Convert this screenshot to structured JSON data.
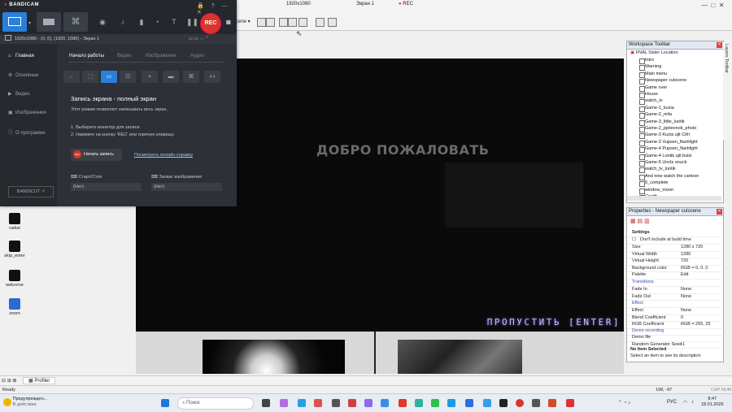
{
  "editor": {
    "tab_title": "1920x1080",
    "tab_title2": "Экран 1",
    "rec_label": "REC",
    "scene_label": "cene",
    "canvas": {
      "welcome_text": "ДОБРО ПОЖАЛОВАТЬ",
      "skip_text": "ПРОПУСТИТЬ [ENTER]"
    }
  },
  "desktop_icons": [
    {
      "label": "radial",
      "icon": "radial-icon"
    },
    {
      "label": "skip_enter",
      "icon": "skip-enter-icon"
    },
    {
      "label": "welcome",
      "icon": "welcome-icon"
    },
    {
      "label": "zoom",
      "icon": "zoom-icon"
    }
  ],
  "bandicam": {
    "logo": "BANDICAM",
    "rec_button": "REC",
    "subtitle": "1920x1080 - (0, 0), (1920, 1080) - Экран 1",
    "sidebar": [
      {
        "label": "Главная",
        "icon": "home-icon",
        "active": true
      },
      {
        "label": "Основные",
        "icon": "gear-icon",
        "active": false
      },
      {
        "label": "Видео",
        "icon": "video-icon",
        "active": false
      },
      {
        "label": "Изображения",
        "icon": "image-icon",
        "active": false
      },
      {
        "label": "О программе",
        "icon": "info-icon",
        "active": false
      }
    ],
    "tabs": [
      "Начало работы",
      "Видео",
      "Изображения",
      "Аудио"
    ],
    "heading": "Запись экрана - полный экран",
    "description": "Этот режим позволяет записывать весь экран.",
    "step1": "1. Выберите монитор для записи.",
    "step2": "2. Нажмите на кнопку 'REC' или горячую клавишу.",
    "start_button": "Начать запись",
    "start_button_badge": "REC",
    "help_link": "Посмотреть онлайн-справку",
    "hotkey_record_label": "Старт/Стоп",
    "hotkey_record_value": "(Нет)",
    "hotkey_capture_label": "Захват изображения",
    "hotkey_capture_value": "(Нет)",
    "bandicut": "BANDICUT ↗"
  },
  "workspace": {
    "title": "Workspace Toolbar",
    "root": "FNAL Sister Location",
    "items": [
      "Intro",
      "Warning",
      "Main menu",
      "Newspaper cutscene",
      "Game over",
      "House",
      "watch_tv",
      "Game-1_kuzia",
      "Game-2_mila",
      "Game-3_little_luntik",
      "Game-2_pjeleonok_photo",
      "Game-3 Kuzia ujit Cifri",
      "Game-3 Vupsen_flashlight",
      "Game-4 Pupsen_flashlight",
      "Game-4 Luntik ujit bulsi",
      "Game-5 Uncle snuck",
      "watch_tv_luntik",
      "And now watch the cartoon",
      "5_complete",
      "window_moon",
      "Credit"
    ]
  },
  "properties": {
    "title": "Properties - Newspaper cutscene",
    "section_settings": "Settings",
    "dont_include": "Don't include at build time",
    "rows": [
      {
        "k": "Size",
        "v": "1280 x 720"
      },
      {
        "k": "Virtual Width",
        "v": "1280"
      },
      {
        "k": "Virtual Height",
        "v": "720"
      },
      {
        "k": "Background color",
        "v": "RGB = 0, 0, 0"
      },
      {
        "k": "Palette",
        "v": "Edit"
      }
    ],
    "section_transitions": "Transitions",
    "trans_rows": [
      {
        "k": "Fade In",
        "v": "None"
      },
      {
        "k": "Fade Out",
        "v": "None"
      }
    ],
    "section_effect": "Effect",
    "effect_rows": [
      {
        "k": "Effect",
        "v": "None"
      },
      {
        "k": "Blend Coefficient",
        "v": "0"
      },
      {
        "k": "RGB Coefficient",
        "v": "RGB = 255, 25"
      }
    ],
    "section_demo": "Demo recording",
    "demo_rows": [
      {
        "k": "Demo file",
        "v": ""
      },
      {
        "k": "Random Generator Seed",
        "v": "-1"
      }
    ],
    "no_item": "No Item Selected",
    "no_item_desc": "Select an item to see its description"
  },
  "side_tabs": [
    "Layers Toolbar"
  ],
  "status": {
    "left": "Ready",
    "profiler_tab": "Profiler",
    "coords": "198, -97",
    "caps": "CAP NUM"
  },
  "taskbar": {
    "notice_title": "Предупрежден...",
    "notice_sub": "В действии",
    "search_placeholder": "Поиск",
    "lang": "РУС",
    "time": "8:47",
    "date": "18.01.2026"
  }
}
